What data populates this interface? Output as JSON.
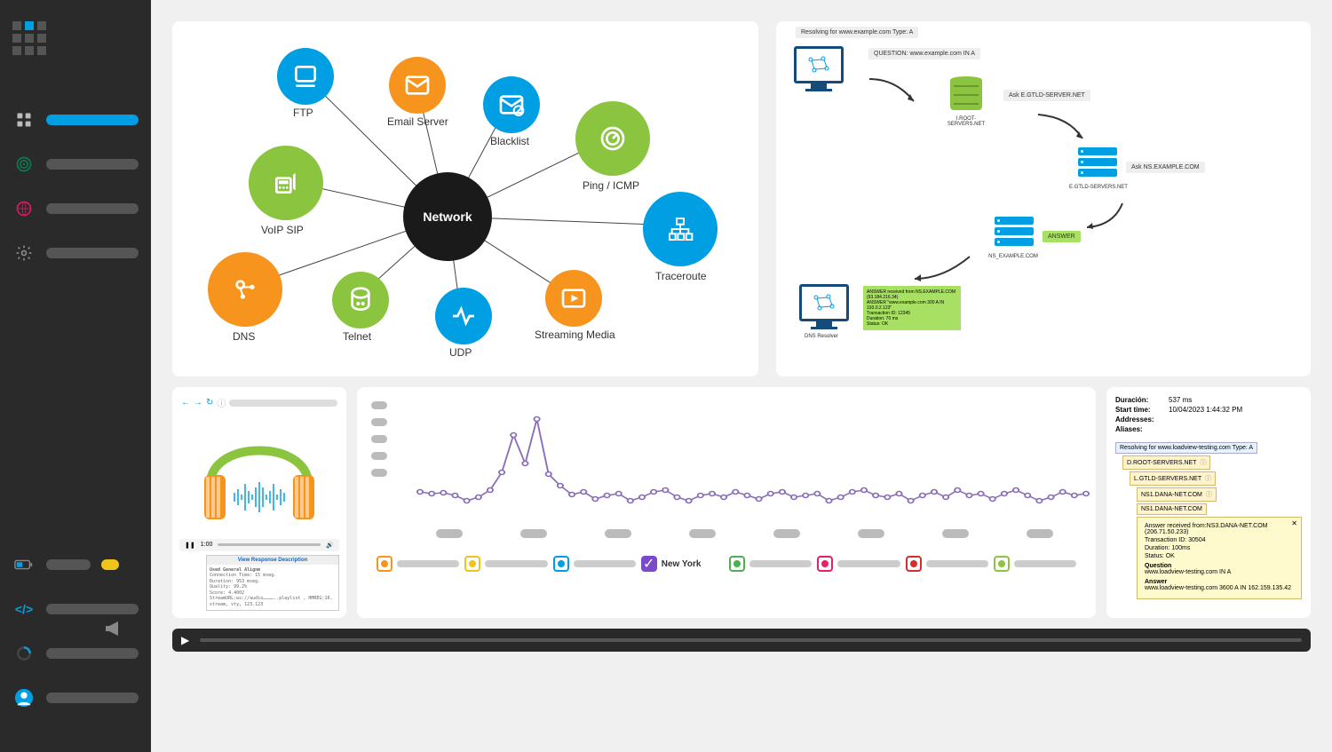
{
  "network": {
    "center": "Network",
    "nodes": [
      {
        "id": "ftp",
        "label": "FTP"
      },
      {
        "id": "email",
        "label": "Email Server"
      },
      {
        "id": "blacklist",
        "label": "Blacklist"
      },
      {
        "id": "ping",
        "label": "Ping / ICMP"
      },
      {
        "id": "traceroute",
        "label": "Traceroute"
      },
      {
        "id": "streaming",
        "label": "Streaming Media"
      },
      {
        "id": "udp",
        "label": "UDP"
      },
      {
        "id": "telnet",
        "label": "Telnet"
      },
      {
        "id": "dns",
        "label": "DNS"
      },
      {
        "id": "voip",
        "label": "VoIP SIP"
      }
    ]
  },
  "dns_flow": {
    "resolving": "Resolving for www.example.com  Type: A",
    "question": "QUESTION: www.example.com IN A",
    "root_label": "I.ROOT-SERVERS.NET",
    "ask_egtld": "Ask E.GTLD-SERVER.NET",
    "egtld_label": "E.GTLD-SERVERS.NET",
    "ask_ns": "Ask NS.EXAMPLE.COM",
    "ns_label": "NS_EXAMPLE.COM",
    "answer_badge": "ANSWER",
    "resolver_label": "DNS Resolver",
    "answer_box": {
      "l1": "ANSWER received from NS.EXAMPLE.COM (93.184.216.34)",
      "l2": "ANSWER \"www.example.com 300 A IN 193.0.2.123\"",
      "l3": "Transaction ID: 12345",
      "l4": "Duration: 70 ms",
      "l5": "Status: OK"
    }
  },
  "audio": {
    "time": "1:00",
    "resp_header": "View Response Description",
    "resp_lines": [
      "Used General Alignm",
      "Connection Time: 15 mseg.",
      "Duration: 953 mseg.",
      "Quality: 99.2%",
      "Score: 4.4002",
      "StreamURL:ws://audio…………..playlist , HMREG:10, stream, vty, 123.123"
    ]
  },
  "graph": {
    "selected_location": "New York"
  },
  "detail": {
    "meta": {
      "duration_k": "Duración:",
      "duration_v": "537 ms",
      "start_k": "Start time:",
      "start_v": "10/04/2023 1:44:32 PM",
      "addresses_k": "Addresses:",
      "aliases_k": "Aliases:"
    },
    "tree": {
      "root": "Resolving for  www.loadview-testing.com  Type: A",
      "n1": "D.ROOT-SERVERS.NET",
      "n2": "L.GTLD-SERVERS.NET",
      "n3": "NS1.DANA-NET.COM",
      "n4": "NS1.DANA-NET.COM"
    },
    "tooltip": {
      "l1": "Answer received from:NS3.DANA-NET.COM (206.71.50.233)",
      "l2": "Transaction ID: 30504",
      "l3": "Duration: 100ms",
      "l4": "Status: OK",
      "q_hdr": "Question",
      "q": "www.loadview-testing.com IN A",
      "a_hdr": "Answer",
      "a": "www.loadview-testing.com 3600 A IN 162.159.135.42"
    }
  },
  "chart_data": {
    "type": "line",
    "title": "",
    "xlabel": "",
    "ylabel": "",
    "y": [
      28,
      26,
      27,
      24,
      18,
      22,
      30,
      50,
      92,
      60,
      110,
      48,
      35,
      25,
      28,
      20,
      24,
      26,
      18,
      22,
      28,
      30,
      22,
      18,
      24,
      26,
      22,
      28,
      24,
      20,
      26,
      28,
      22,
      24,
      26,
      18,
      22,
      28,
      30,
      24,
      22,
      26,
      18,
      24,
      28,
      22,
      30,
      24,
      26,
      20,
      26,
      30,
      24,
      18,
      22,
      28,
      24,
      26
    ]
  }
}
